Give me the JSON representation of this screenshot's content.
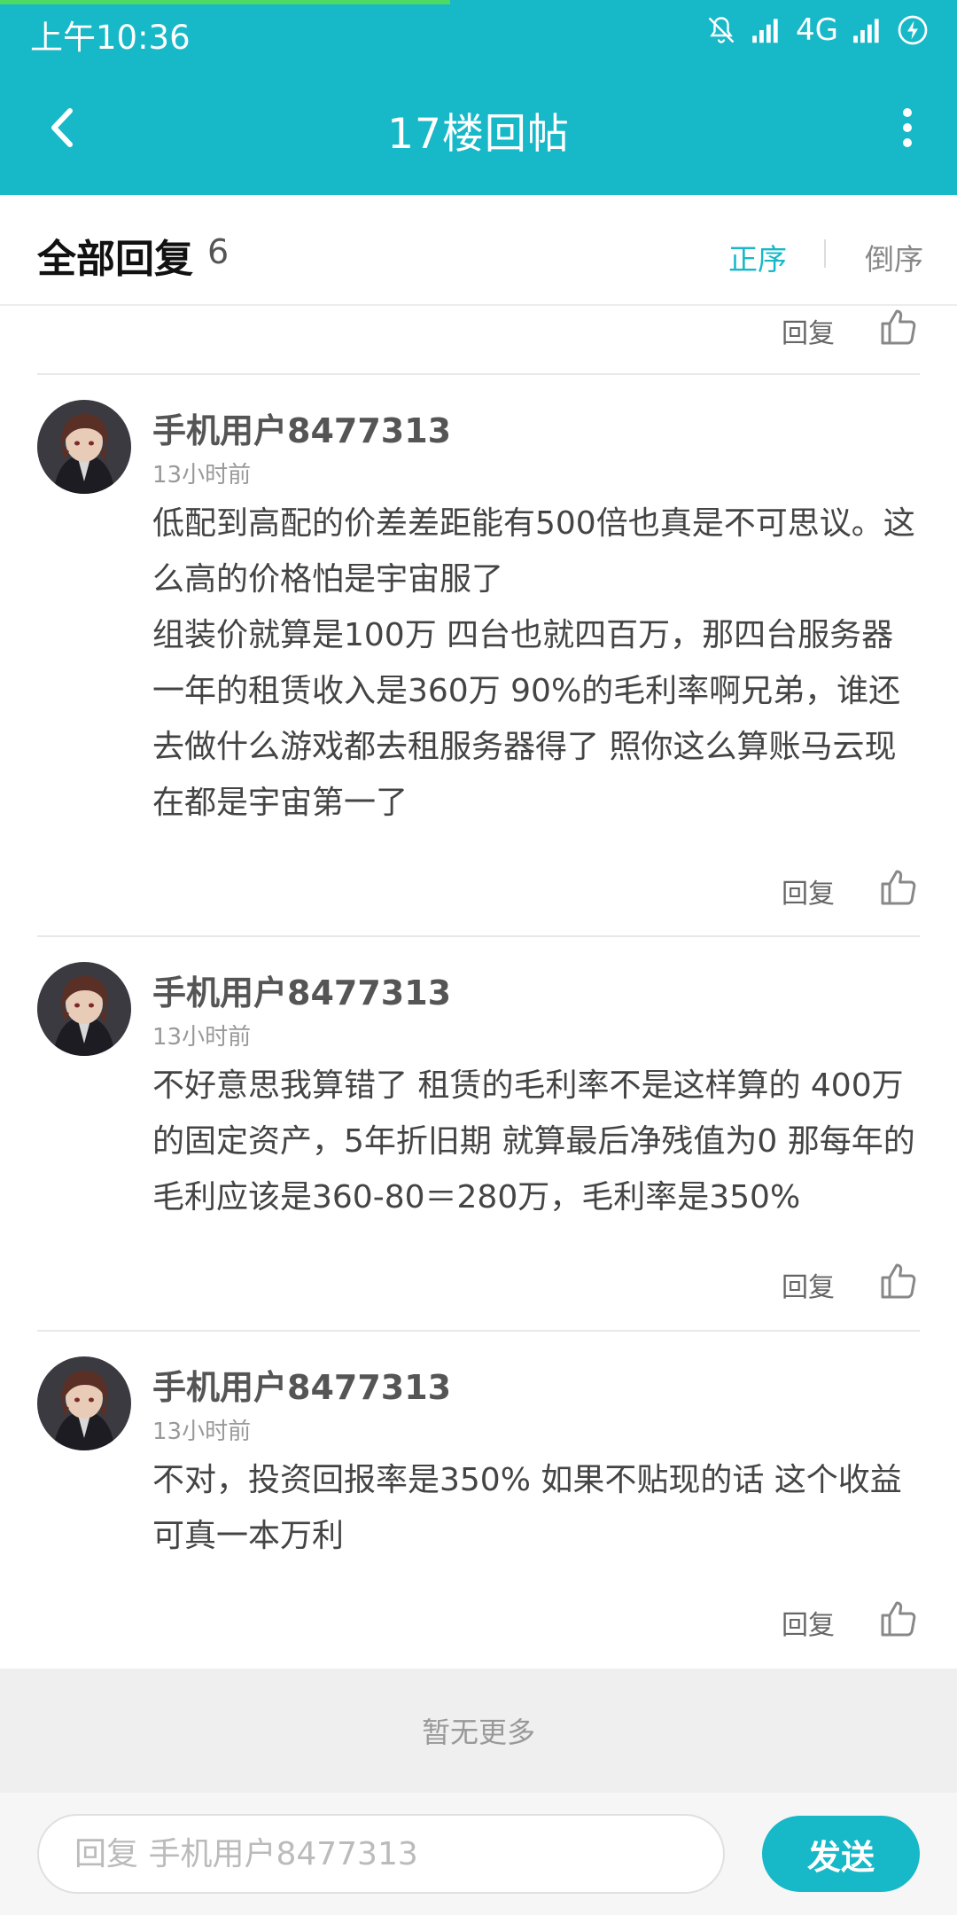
{
  "status_bar": {
    "time": "上午10:36",
    "network": "4G",
    "page_load_progress": 0.47
  },
  "app_bar": {
    "title": "17楼回帖",
    "back_icon": "back-arrow-icon",
    "more_icon": "more-vertical-icon"
  },
  "section": {
    "title": "全部回复",
    "count": "6",
    "sort_asc": "正序",
    "sort_desc": "倒序"
  },
  "actions": {
    "reply_label": "回复",
    "like_icon": "thumbs-up-icon"
  },
  "replies": [
    {
      "username": "手机用户8477313",
      "time": "13小时前",
      "content": "低配到高配的价差差距能有500倍也真是不可思议。这么高的价格怕是宇宙服了\n组装价就算是100万 四台也就四百万，那四台服务器一年的租赁收入是360万 90%的毛利率啊兄弟，谁还去做什么游戏都去租服务器得了 照你这么算账马云现在都是宇宙第一了"
    },
    {
      "username": "手机用户8477313",
      "time": "13小时前",
      "content": "不好意思我算错了 租赁的毛利率不是这样算的 400万的固定资产，5年折旧期 就算最后净残值为0 那每年的毛利应该是360-80＝280万，毛利率是350%"
    },
    {
      "username": "手机用户8477313",
      "time": "13小时前",
      "content": "不对，投资回报率是350% 如果不贴现的话 这个收益可真一本万利"
    }
  ],
  "footer": {
    "no_more": "暂无更多",
    "input_placeholder": "回复 手机用户8477313",
    "send_label": "发送"
  },
  "colors": {
    "accent": "#17b8c7",
    "progress": "#4cd964"
  }
}
